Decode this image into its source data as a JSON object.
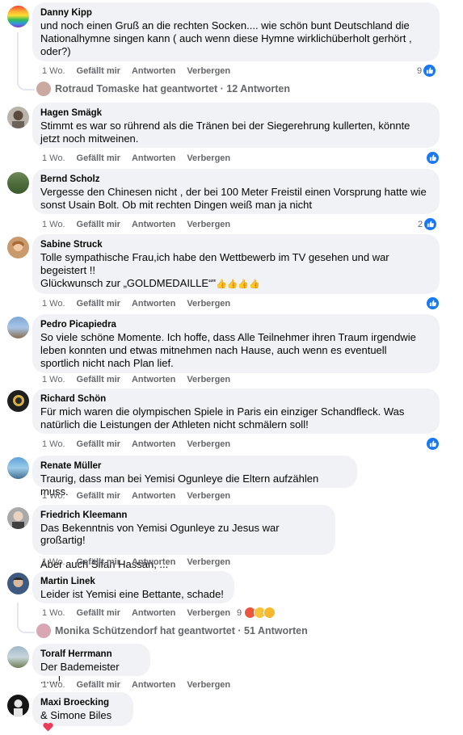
{
  "actions": {
    "time": "1 Wo.",
    "like": "Gefällt mir",
    "reply": "Antworten",
    "hide": "Verbergen"
  },
  "comments": [
    {
      "author": "Danny Kipp",
      "text": "und noch einen Gruß an die rechten Socken.... wie schön bunt Deutschland die\nNationalhymne singen kann ( auch wenn diese Hymne wirklichüberholt gerhört ,\noder?)",
      "reactions": "9",
      "replies": "Rotraud Tomaske hat geantwortet · 12 Antworten"
    },
    {
      "author": "Hagen Smägk",
      "text": "Stimmt es war so rührend als die Tränen bei der Siegerehrung kullerten, könnte\njetzt noch mitweinen.",
      "reactions": ""
    },
    {
      "author": "Bernd Scholz",
      "text": "Vergesse den Chinesen nicht , der bei 100 Meter Freistil einen Vorsprung hatte wie\nsonst Usain Bolt. Ob mit rechten Dingen weiß man ja nicht",
      "reactions": "2"
    },
    {
      "author": "Sabine Struck",
      "text": "Tolle sympathische Frau,ich habe den Wettbewerb im TV gesehen und war\nbegeistert !!\nGlückwunsch zur „GOLDMEDAILLE“\"",
      "emoji_tail": "👍👍👍👍",
      "reactions": ""
    },
    {
      "author": "Pedro Picapiedra",
      "text": "So viele schöne Momente. Ich hoffe, dass Alle Teilnehmer ihren Traum irgendwie\nleben konnten und etwas mitnehmen nach Hause, auch wenn es eventuell\nsportlich nicht nach Plan lief.",
      "reactions": ""
    },
    {
      "author": "Richard Schön",
      "text": "Für mich waren die olympischen Spiele in Paris ein einziger Schandfleck. Was\nnatürlich die Leistungen der Athleten nicht schmälern soll!",
      "reactions": ""
    },
    {
      "author": "Renate Müller",
      "text": "Traurig, dass man bei Yemisi Ogunleye die Eltern aufzählen muss.",
      "reactions": ""
    },
    {
      "author": "Friedrich Kleemann",
      "text": "Das Bekenntnis von Yemisi Ogunleye zu Jesus war großartig!\n\nAber auch Sifan Hassan, ...",
      "reactions": ""
    },
    {
      "author": "Martin Linek",
      "text": "Leider ist Yemisi eine Bettante, schade!",
      "reactions": "9",
      "replies": "Monika Schützendorf hat geantwortet · 51 Antworten"
    },
    {
      "author": "Toralf Herrmann",
      "text": "Der Bademeister ......!",
      "reactions": ""
    },
    {
      "author": "Maxi Broecking",
      "text": "& Simone Biles",
      "reactions": ""
    }
  ],
  "colors": {
    "like_blue": "#1877f2",
    "bubble": "#f0f2f5",
    "meta": "#65676b"
  }
}
